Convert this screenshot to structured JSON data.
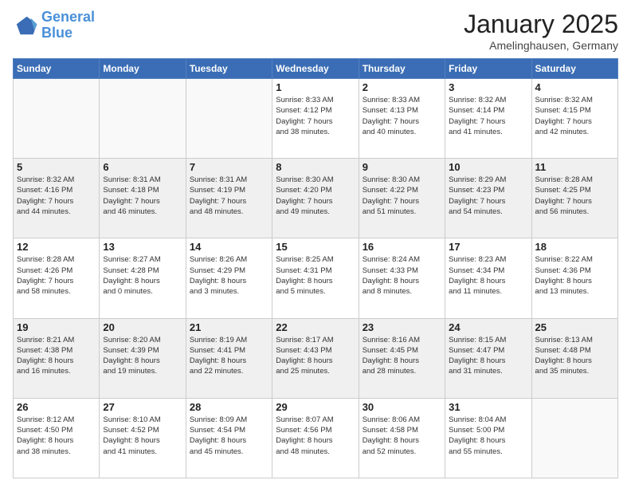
{
  "logo": {
    "line1": "General",
    "line2": "Blue"
  },
  "title": "January 2025",
  "location": "Amelinghausen, Germany",
  "weekdays": [
    "Sunday",
    "Monday",
    "Tuesday",
    "Wednesday",
    "Thursday",
    "Friday",
    "Saturday"
  ],
  "weeks": [
    [
      {
        "day": "",
        "info": ""
      },
      {
        "day": "",
        "info": ""
      },
      {
        "day": "",
        "info": ""
      },
      {
        "day": "1",
        "info": "Sunrise: 8:33 AM\nSunset: 4:12 PM\nDaylight: 7 hours\nand 38 minutes."
      },
      {
        "day": "2",
        "info": "Sunrise: 8:33 AM\nSunset: 4:13 PM\nDaylight: 7 hours\nand 40 minutes."
      },
      {
        "day": "3",
        "info": "Sunrise: 8:32 AM\nSunset: 4:14 PM\nDaylight: 7 hours\nand 41 minutes."
      },
      {
        "day": "4",
        "info": "Sunrise: 8:32 AM\nSunset: 4:15 PM\nDaylight: 7 hours\nand 42 minutes."
      }
    ],
    [
      {
        "day": "5",
        "info": "Sunrise: 8:32 AM\nSunset: 4:16 PM\nDaylight: 7 hours\nand 44 minutes."
      },
      {
        "day": "6",
        "info": "Sunrise: 8:31 AM\nSunset: 4:18 PM\nDaylight: 7 hours\nand 46 minutes."
      },
      {
        "day": "7",
        "info": "Sunrise: 8:31 AM\nSunset: 4:19 PM\nDaylight: 7 hours\nand 48 minutes."
      },
      {
        "day": "8",
        "info": "Sunrise: 8:30 AM\nSunset: 4:20 PM\nDaylight: 7 hours\nand 49 minutes."
      },
      {
        "day": "9",
        "info": "Sunrise: 8:30 AM\nSunset: 4:22 PM\nDaylight: 7 hours\nand 51 minutes."
      },
      {
        "day": "10",
        "info": "Sunrise: 8:29 AM\nSunset: 4:23 PM\nDaylight: 7 hours\nand 54 minutes."
      },
      {
        "day": "11",
        "info": "Sunrise: 8:28 AM\nSunset: 4:25 PM\nDaylight: 7 hours\nand 56 minutes."
      }
    ],
    [
      {
        "day": "12",
        "info": "Sunrise: 8:28 AM\nSunset: 4:26 PM\nDaylight: 7 hours\nand 58 minutes."
      },
      {
        "day": "13",
        "info": "Sunrise: 8:27 AM\nSunset: 4:28 PM\nDaylight: 8 hours\nand 0 minutes."
      },
      {
        "day": "14",
        "info": "Sunrise: 8:26 AM\nSunset: 4:29 PM\nDaylight: 8 hours\nand 3 minutes."
      },
      {
        "day": "15",
        "info": "Sunrise: 8:25 AM\nSunset: 4:31 PM\nDaylight: 8 hours\nand 5 minutes."
      },
      {
        "day": "16",
        "info": "Sunrise: 8:24 AM\nSunset: 4:33 PM\nDaylight: 8 hours\nand 8 minutes."
      },
      {
        "day": "17",
        "info": "Sunrise: 8:23 AM\nSunset: 4:34 PM\nDaylight: 8 hours\nand 11 minutes."
      },
      {
        "day": "18",
        "info": "Sunrise: 8:22 AM\nSunset: 4:36 PM\nDaylight: 8 hours\nand 13 minutes."
      }
    ],
    [
      {
        "day": "19",
        "info": "Sunrise: 8:21 AM\nSunset: 4:38 PM\nDaylight: 8 hours\nand 16 minutes."
      },
      {
        "day": "20",
        "info": "Sunrise: 8:20 AM\nSunset: 4:39 PM\nDaylight: 8 hours\nand 19 minutes."
      },
      {
        "day": "21",
        "info": "Sunrise: 8:19 AM\nSunset: 4:41 PM\nDaylight: 8 hours\nand 22 minutes."
      },
      {
        "day": "22",
        "info": "Sunrise: 8:17 AM\nSunset: 4:43 PM\nDaylight: 8 hours\nand 25 minutes."
      },
      {
        "day": "23",
        "info": "Sunrise: 8:16 AM\nSunset: 4:45 PM\nDaylight: 8 hours\nand 28 minutes."
      },
      {
        "day": "24",
        "info": "Sunrise: 8:15 AM\nSunset: 4:47 PM\nDaylight: 8 hours\nand 31 minutes."
      },
      {
        "day": "25",
        "info": "Sunrise: 8:13 AM\nSunset: 4:48 PM\nDaylight: 8 hours\nand 35 minutes."
      }
    ],
    [
      {
        "day": "26",
        "info": "Sunrise: 8:12 AM\nSunset: 4:50 PM\nDaylight: 8 hours\nand 38 minutes."
      },
      {
        "day": "27",
        "info": "Sunrise: 8:10 AM\nSunset: 4:52 PM\nDaylight: 8 hours\nand 41 minutes."
      },
      {
        "day": "28",
        "info": "Sunrise: 8:09 AM\nSunset: 4:54 PM\nDaylight: 8 hours\nand 45 minutes."
      },
      {
        "day": "29",
        "info": "Sunrise: 8:07 AM\nSunset: 4:56 PM\nDaylight: 8 hours\nand 48 minutes."
      },
      {
        "day": "30",
        "info": "Sunrise: 8:06 AM\nSunset: 4:58 PM\nDaylight: 8 hours\nand 52 minutes."
      },
      {
        "day": "31",
        "info": "Sunrise: 8:04 AM\nSunset: 5:00 PM\nDaylight: 8 hours\nand 55 minutes."
      },
      {
        "day": "",
        "info": ""
      }
    ]
  ]
}
